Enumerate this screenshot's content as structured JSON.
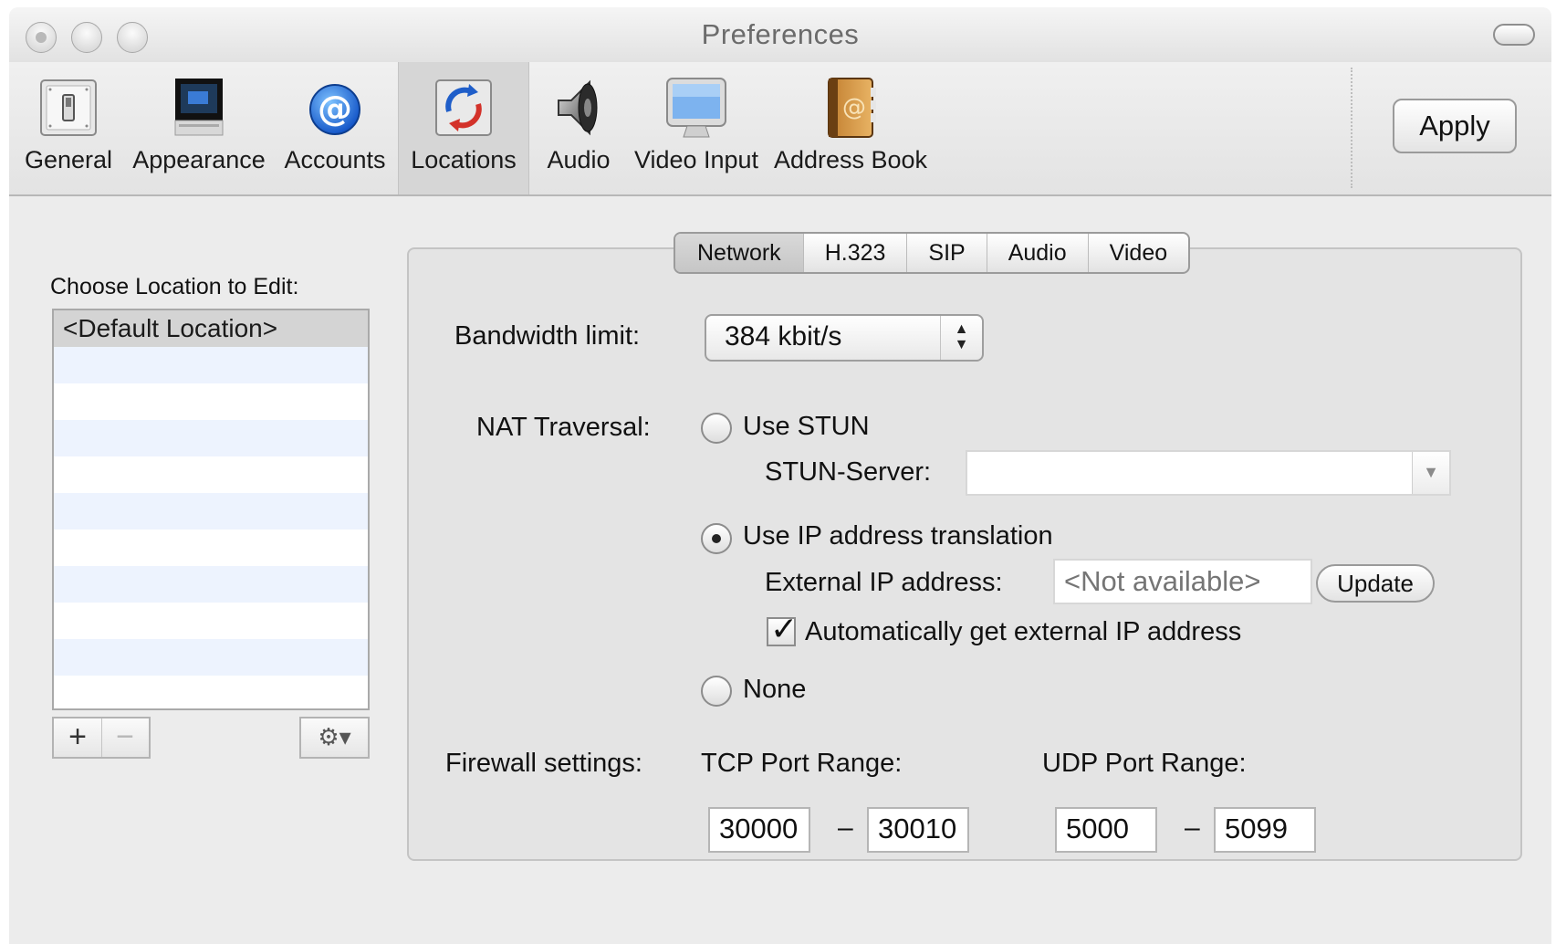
{
  "window": {
    "title": "Preferences"
  },
  "toolbar": {
    "items": [
      {
        "label": "General",
        "icon": "switch-icon"
      },
      {
        "label": "Appearance",
        "icon": "monitor-icon"
      },
      {
        "label": "Accounts",
        "icon": "at-sign-icon"
      },
      {
        "label": "Locations",
        "icon": "locations-icon",
        "selected": true
      },
      {
        "label": "Audio",
        "icon": "speaker-icon"
      },
      {
        "label": "Video Input",
        "icon": "display-icon"
      },
      {
        "label": "Address Book",
        "icon": "address-book-icon"
      }
    ],
    "apply_label": "Apply"
  },
  "locations": {
    "label": "Choose Location to Edit:",
    "items": [
      "<Default Location>"
    ],
    "add_label": "+",
    "remove_label": "−",
    "gear_label": "⚙▾"
  },
  "tabs": {
    "items": [
      "Network",
      "H.323",
      "SIP",
      "Audio",
      "Video"
    ],
    "active": "Network"
  },
  "network": {
    "bandwidth_label": "Bandwidth limit:",
    "bandwidth_value": "384 kbit/s",
    "nat_label": "NAT Traversal:",
    "use_stun_label": "Use STUN",
    "stun_server_label": "STUN-Server:",
    "stun_server_value": "",
    "use_ip_translation_label": "Use IP address translation",
    "external_ip_label": "External IP address:",
    "external_ip_placeholder": "<Not available>",
    "update_label": "Update",
    "auto_ip_label": "Automatically get external IP address",
    "auto_ip_checked": true,
    "none_label": "None",
    "selected_nat": "Use IP address translation",
    "firewall_label": "Firewall settings:",
    "tcp_label": "TCP Port Range:",
    "tcp_from": "30000",
    "tcp_to": "30010",
    "udp_label": "UDP Port Range:",
    "udp_from": "5000",
    "udp_to": "5099",
    "range_separator": "–"
  },
  "colors": {
    "window_bg": "#ececec",
    "panel_bg": "#e4e4e4",
    "list_stripe": "#edf3fe",
    "selected_row": "#d4d4d4"
  }
}
